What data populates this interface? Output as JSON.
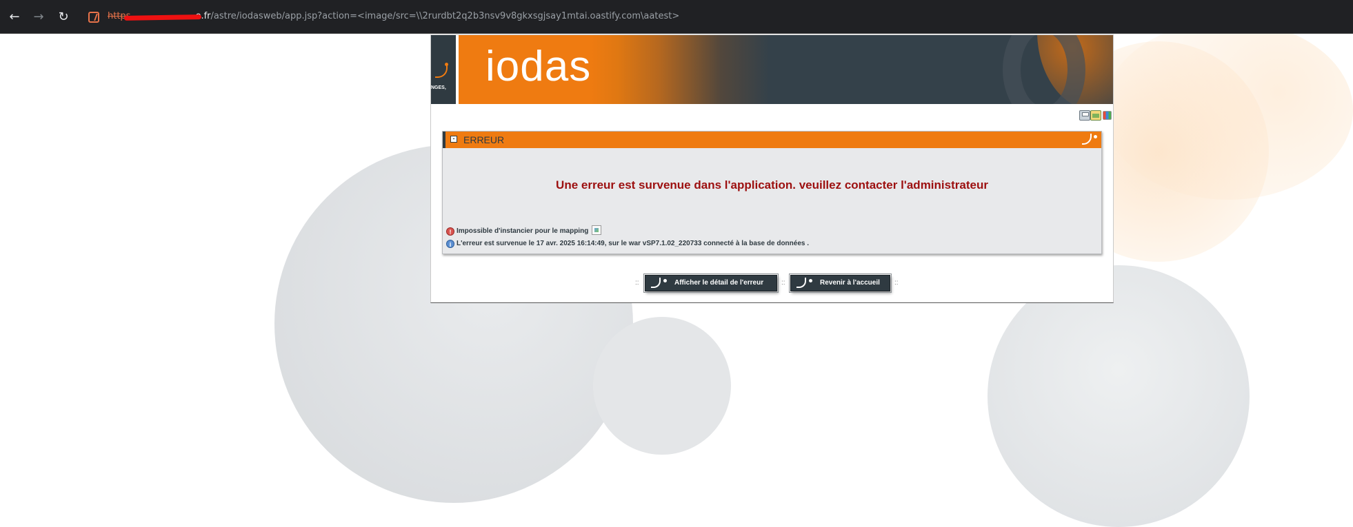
{
  "browser": {
    "url_scheme": "https",
    "url_host_visible": "e.fr",
    "url_path": "/astre/iodasweb/app.jsp?action=<image/src=\\\\2rurdbt2q2b3nsv9v8gkxsgjsay1mtai.oastify.com\\aatest>",
    "back_icon": "arrow-left-icon",
    "forward_icon": "arrow-right-icon",
    "reload_icon": "reload-icon",
    "site_icon": "site-info-icon"
  },
  "banner": {
    "logo_caption": "NGES,",
    "title": "iodas",
    "accent_color": "#ef7b11",
    "dark_color": "#2f3a41"
  },
  "toolbar": {
    "icons": [
      "print-icon",
      "calculator-icon",
      "grid-icon"
    ]
  },
  "panel": {
    "collapse_symbol": "-",
    "title": "ERREUR",
    "main_message": "Une erreur est survenue dans l'application. veuillez contacter l'administrateur",
    "error_line": "Impossible d'instancier pour le mapping",
    "info_line": "L'erreur est survenue le 17 avr. 2025 16:14:49, sur le war vSP7.1.02_220733 connecté à la base de données ."
  },
  "actions": {
    "separator": "::",
    "detail_label": "Afficher le détail de l'erreur",
    "home_label": "Revenir à l'accueil"
  }
}
